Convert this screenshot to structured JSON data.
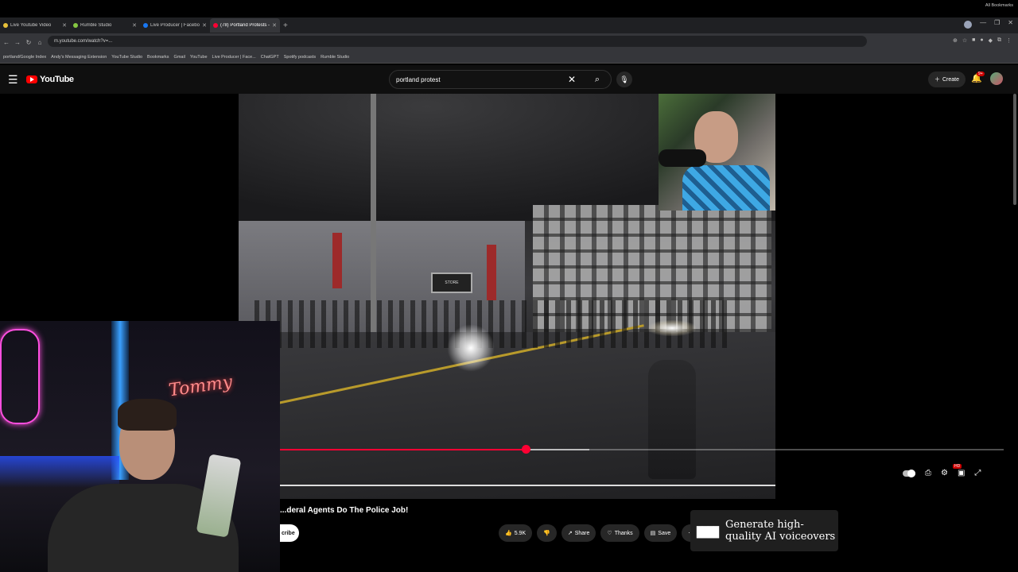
{
  "browser": {
    "tabs": [
      {
        "label": "Live Youtube Video",
        "color": "#e8c13a",
        "active": false
      },
      {
        "label": "Rumble Studio",
        "color": "#85c742",
        "active": false
      },
      {
        "label": "Live Producer | Facebook",
        "color": "#1877f2",
        "active": false
      },
      {
        "label": "(78) Portland Protests - You",
        "color": "#ff0033",
        "active": true
      }
    ],
    "url": "m.youtube.com/watch?v=...",
    "bookmarks": [
      "portland/Google Index",
      "Andy's Messaging Extension",
      "YouTube Studio",
      "Bookmarks",
      "Gmail",
      "YouTube",
      "Live Producer | Face...",
      "ChatGPT",
      "Spotify podcasts",
      "Rumble Studio"
    ],
    "all_bookmarks": "All Bookmarks"
  },
  "youtube": {
    "logo_text": "YouTube",
    "search_value": "portland protest",
    "create_label": "Create",
    "notif_count": "9+"
  },
  "video": {
    "title": "...deral Agents Do The Police Job!",
    "progress_fraction": 0.34,
    "subscribe_label": "cribe",
    "likes": "5.9K",
    "share_label": "Share",
    "thanks_label": "Thanks",
    "save_label": "Save",
    "hd_badge": "HD",
    "store_sign": "STORE"
  },
  "overlay": {
    "neon_name": "Tommy"
  },
  "ad": {
    "text": "Generate high-quality AI voiceovers"
  }
}
